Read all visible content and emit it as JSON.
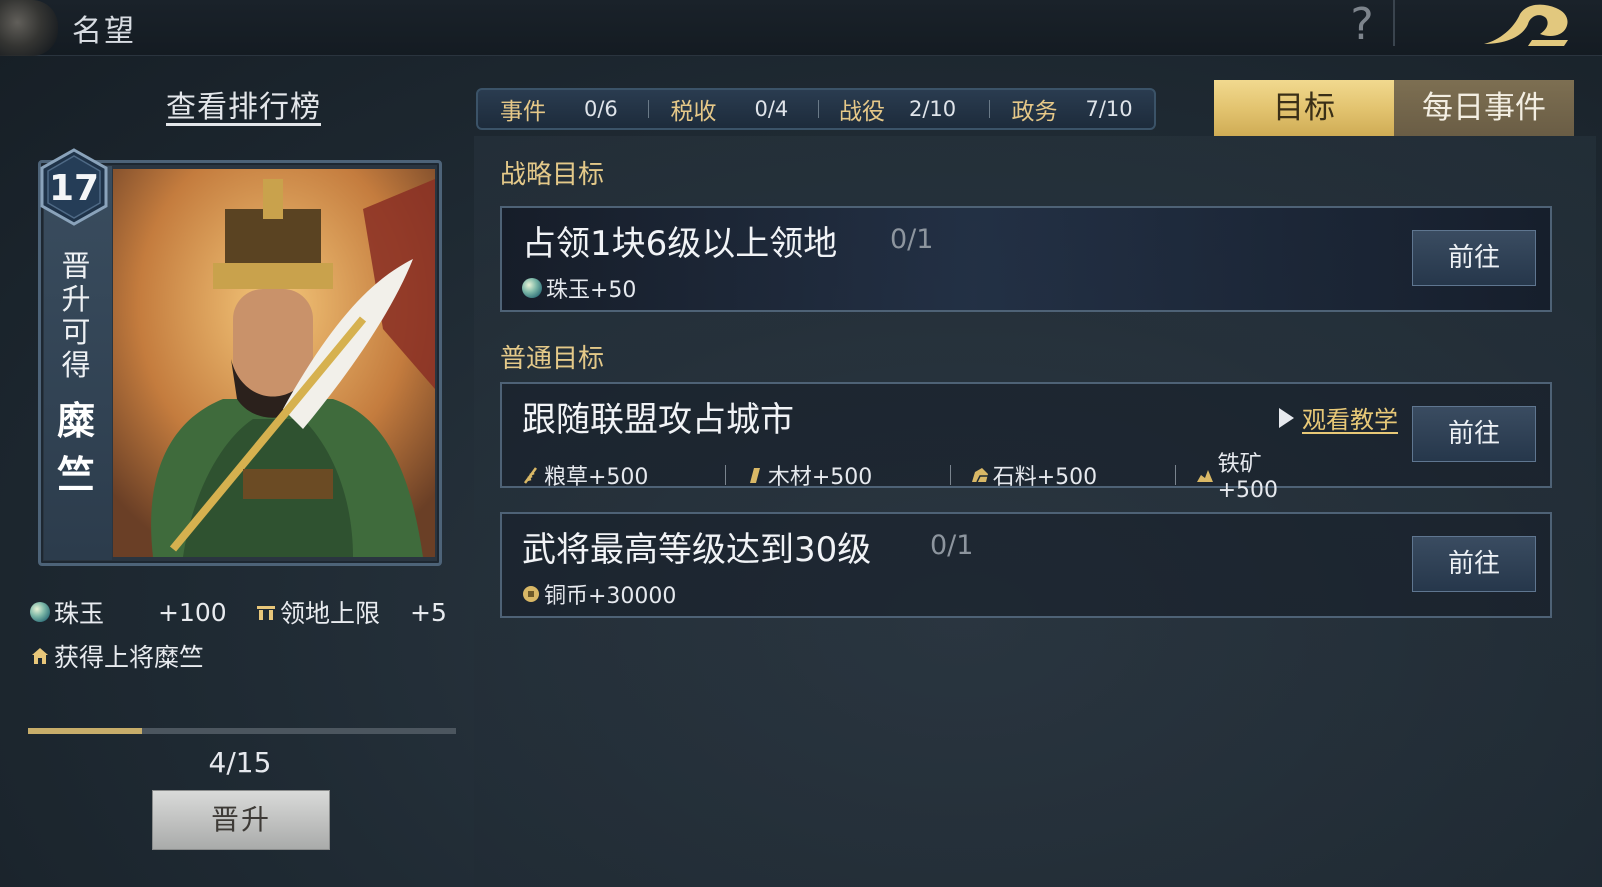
{
  "header": {
    "title": "名望",
    "help_symbol": "?",
    "icons": {
      "emblem": "emblem-icon",
      "help": "help-icon",
      "back": "back-arrow-icon"
    }
  },
  "left": {
    "view_rank_label": "查看排行榜",
    "card": {
      "level": "17",
      "promote_hint": [
        "晋",
        "升",
        "可",
        "得"
      ],
      "general_name": [
        "糜",
        "竺"
      ]
    },
    "rewards": {
      "jade_label": "珠玉",
      "jade_value": "+100",
      "territory_label": "领地上限",
      "territory_value": "+5",
      "general_text": "获得上将糜竺"
    },
    "progress": {
      "text": "4/15",
      "current": 4,
      "total": 15
    },
    "promote_button": "晋升"
  },
  "stats": [
    {
      "label": "事件",
      "value": "0/6"
    },
    {
      "label": "税收",
      "value": "0/4"
    },
    {
      "label": "战役",
      "value": "2/10"
    },
    {
      "label": "政务",
      "value": "7/10"
    }
  ],
  "tabs": {
    "goal": "目标",
    "daily": "每日事件",
    "active": "goal"
  },
  "sections": {
    "strategic": "战略目标",
    "normal": "普通目标"
  },
  "tasks": [
    {
      "title": "占领1块6级以上领地",
      "progress": "0/1",
      "rewards": [
        {
          "icon": "jade-icon",
          "text": "珠玉+50"
        }
      ],
      "button": "前往"
    },
    {
      "title": "跟随联盟攻占城市",
      "watch_label": "观看教学",
      "rewards": [
        {
          "icon": "grain-icon",
          "text": "粮草+500"
        },
        {
          "icon": "wood-icon",
          "text": "木材+500"
        },
        {
          "icon": "stone-icon",
          "text": "石料+500"
        },
        {
          "icon": "iron-icon",
          "text": "铁矿+500"
        }
      ],
      "button": "前往"
    },
    {
      "title": "武将最高等级达到30级",
      "progress": "0/1",
      "rewards": [
        {
          "icon": "copper-coin-icon",
          "text": "铜币+30000"
        }
      ],
      "button": "前往"
    }
  ],
  "colors": {
    "gold_text": "#e4c989",
    "tab_active": "#e3c470",
    "tab_inactive": "#6a5d45",
    "progress_fill": "#c7ad6a"
  }
}
